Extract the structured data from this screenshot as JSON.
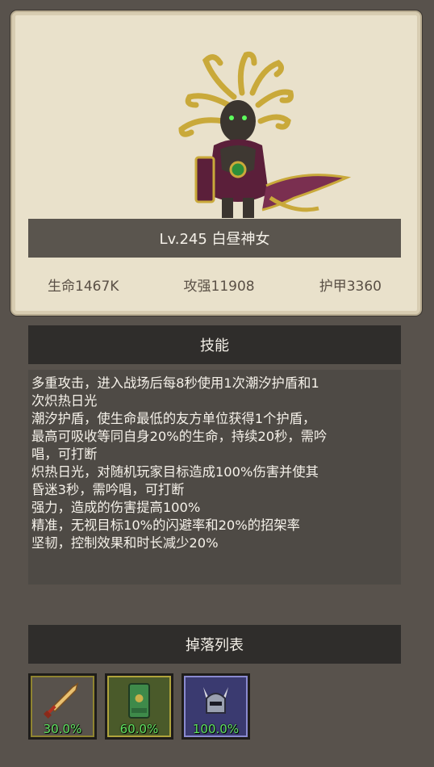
{
  "hero": {
    "name": "Lv.245 白昼神女",
    "stats": {
      "hp": "生命1467K",
      "attack": "攻强11908",
      "armor": "护甲3360"
    }
  },
  "skills": {
    "header": "技能",
    "lines": [
      "多重攻击，进入战场后每8秒使用1次潮汐护盾和1",
      "次炽热日光",
      "潮汐护盾，使生命最低的友方单位获得1个护盾，",
      "最高可吸收等同自身20%的生命，持续20秒，需吟",
      "唱，可打断",
      "炽热日光，对随机玩家目标造成100%伤害并使其",
      "昏迷3秒，需吟唱，可打断",
      "强力，造成的伤害提高100%",
      "精准，无视目标10%的闪避率和20%的招架率",
      "坚韧，控制效果和时长减少20%"
    ]
  },
  "drops": {
    "header": "掉落列表",
    "items": [
      {
        "icon": "dagger-icon",
        "rate": "30.0%"
      },
      {
        "icon": "green-armor-icon",
        "rate": "60.0%"
      },
      {
        "icon": "horned-helmet-icon",
        "rate": "100.0%"
      }
    ]
  }
}
